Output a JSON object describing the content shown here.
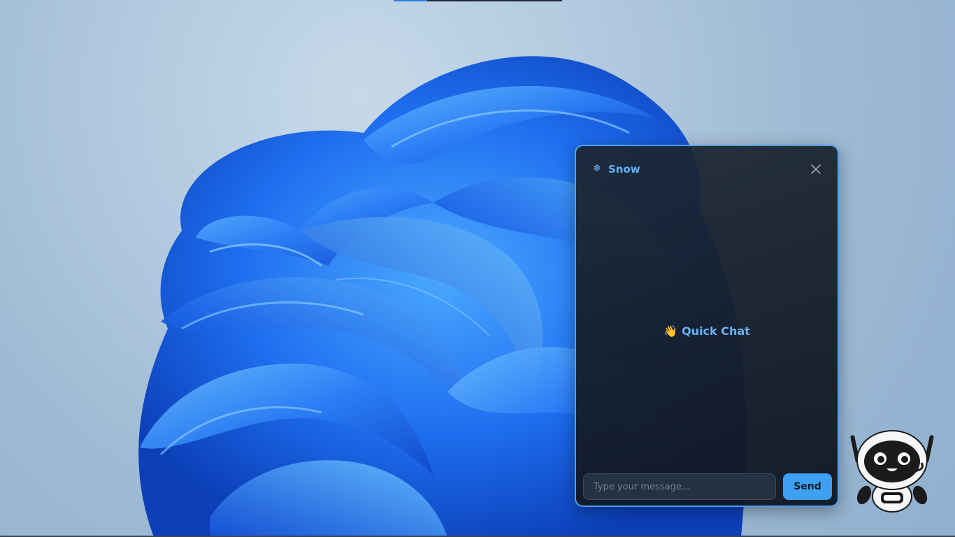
{
  "top_strip": {
    "progress": 0.2,
    "color": "#2f7fe0"
  },
  "chat": {
    "title": "Snow",
    "logo_icon": "snowflake-icon",
    "close_icon": "close-icon",
    "welcome_emoji": "👋",
    "welcome_text": "Quick Chat",
    "input_placeholder": "Type your message...",
    "send_label": "Send",
    "accent_color": "#4aa3f0"
  },
  "mascot": {
    "icon": "robot-icon"
  }
}
